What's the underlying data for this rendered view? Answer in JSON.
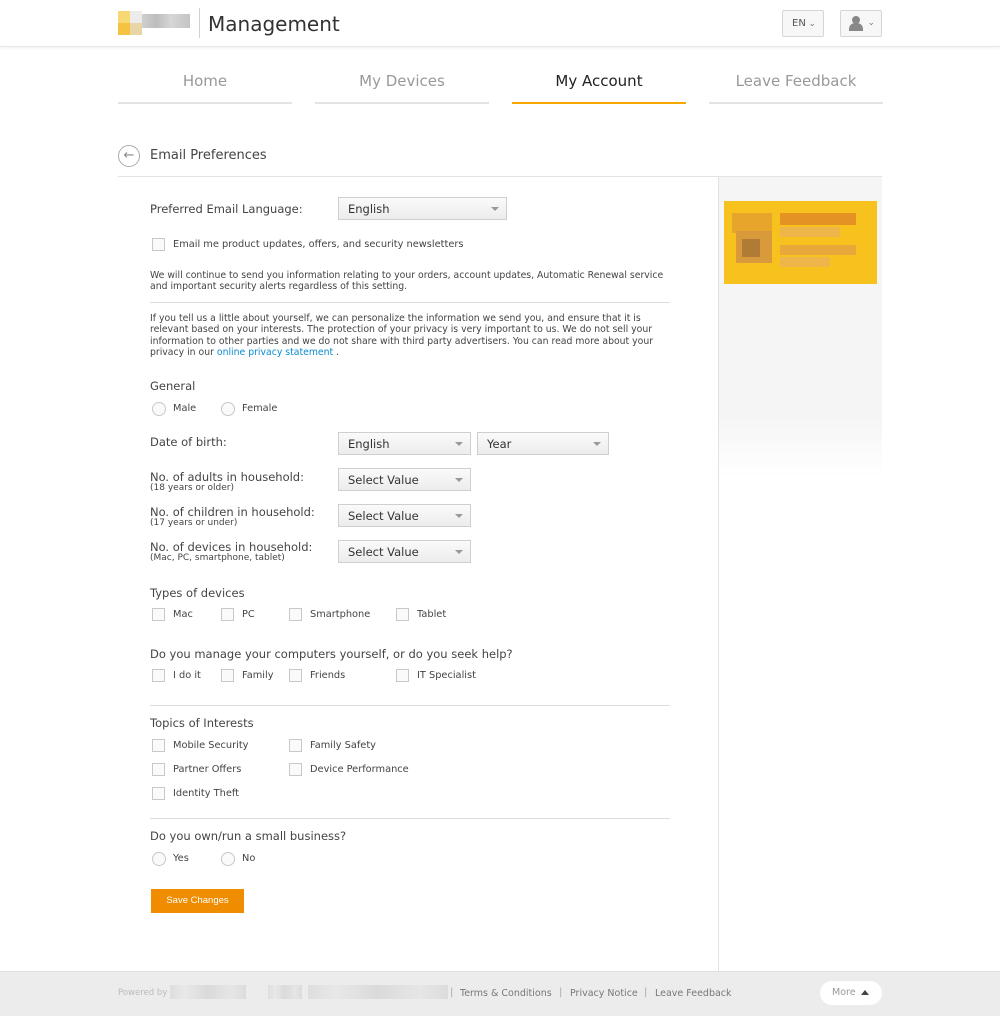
{
  "header": {
    "brand": "Management",
    "lang_button": "EN"
  },
  "tabs": [
    {
      "label": "Home"
    },
    {
      "label": "My Devices"
    },
    {
      "label": "My Account"
    },
    {
      "label": "Leave Feedback"
    }
  ],
  "page": {
    "title": "Email Preferences"
  },
  "form": {
    "email_language_label": "Preferred Email Language:",
    "email_language_value": "English",
    "newsletter_label": "Email me product updates, offers, and security newsletters",
    "notice_text": "We will continue to send you information relating to your orders, account updates, Automatic Renewal service and important security alerts regardless of this setting.",
    "privacy_text": "If you tell us a little about yourself, we can personalize the information we send you, and ensure that it is relevant based on your interests. The protection of your privacy is very important to us. We do not sell your information to other parties and we do not share with third party advertisers. You can read more about your privacy in our",
    "privacy_link": "online privacy statement",
    "privacy_end": ".",
    "general_label": "General",
    "gender_options": [
      "Male",
      "Female"
    ],
    "dob_label": "Date of birth:",
    "dob_month_value": "English",
    "dob_year_value": "Year",
    "adults_label": "No. of adults in household:",
    "adults_sub": "(18 years or older)",
    "adults_value": "Select Value",
    "children_label": "No. of children in household:",
    "children_sub": "(17 years or under)",
    "children_value": "Select Value",
    "devices_label": "No. of devices in household:",
    "devices_sub": "(Mac, PC, smartphone, tablet)",
    "devices_value": "Select Value",
    "device_types_label": "Types of devices",
    "device_types": [
      "Mac",
      "PC",
      "Smartphone",
      "Tablet"
    ],
    "manage_label": "Do you manage your computers yourself, or do you seek help?",
    "manage_options": [
      "I do it",
      "Family",
      "Friends",
      "IT Specialist"
    ],
    "topics_label": "Topics of Interests",
    "topics": [
      "Mobile Security",
      "Family Safety",
      "Partner Offers",
      "Device Performance",
      "Identity Theft"
    ],
    "business_label": "Do you own/run a small business?",
    "business_options": [
      "Yes",
      "No"
    ],
    "save_label": "Save Changes"
  },
  "footer": {
    "powered_by": "Powered by",
    "links": [
      "Terms & Conditions",
      "Privacy Notice",
      "Leave Feedback"
    ],
    "separator": "|",
    "more_label": "More"
  },
  "colors": {
    "accent": "#f7a800",
    "save_button": "#f08c00",
    "link": "#0a8ccf",
    "promo": "#f7c21d"
  },
  "icons": {
    "back": "arrow-left-circle-icon",
    "user": "user-icon",
    "chevron": "chevron-down-icon",
    "more": "caret-up-icon"
  }
}
